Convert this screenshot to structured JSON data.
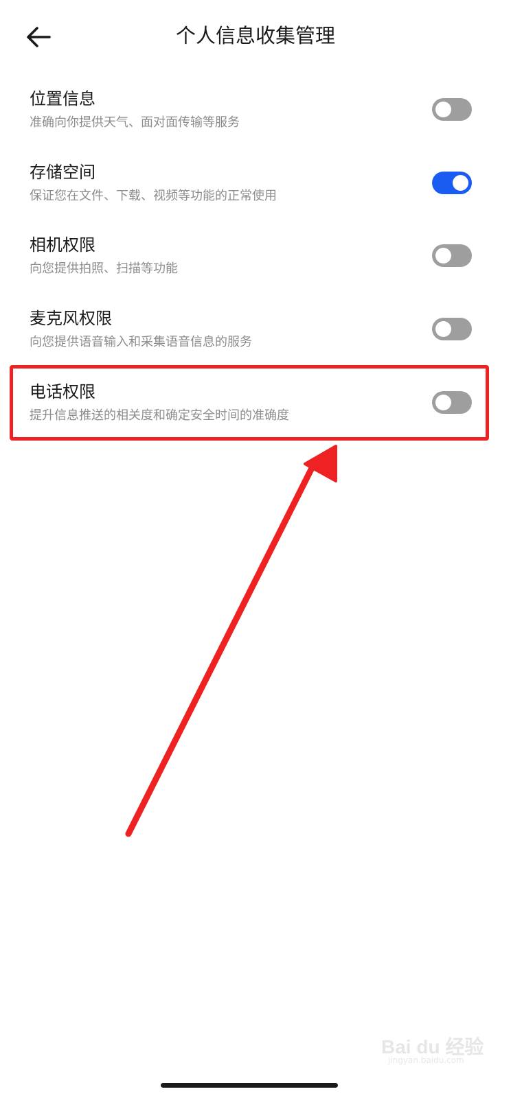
{
  "header": {
    "title": "个人信息收集管理",
    "back_icon": "arrow-left-icon"
  },
  "settings": [
    {
      "title": "位置信息",
      "description": "准确向你提供天气、面对面传输等服务",
      "enabled": false
    },
    {
      "title": "存储空间",
      "description": "保证您在文件、下载、视频等功能的正常使用",
      "enabled": true
    },
    {
      "title": "相机权限",
      "description": "向您提供拍照、扫描等功能",
      "enabled": false
    },
    {
      "title": "麦克风权限",
      "description": "向您提供语音输入和采集语音信息的服务",
      "enabled": false
    },
    {
      "title": "电话权限",
      "description": "提升信息推送的相关度和确定安全时间的准确度",
      "enabled": false
    }
  ],
  "annotation": {
    "highlight_color": "#ee2222",
    "highlighted_item": "电话权限"
  },
  "colors": {
    "toggle_on": "#1a5cf2",
    "toggle_off": "#9e9e9e"
  },
  "watermark": {
    "text": "Bai du 经验",
    "sub": "jingyan.baidu.com"
  }
}
